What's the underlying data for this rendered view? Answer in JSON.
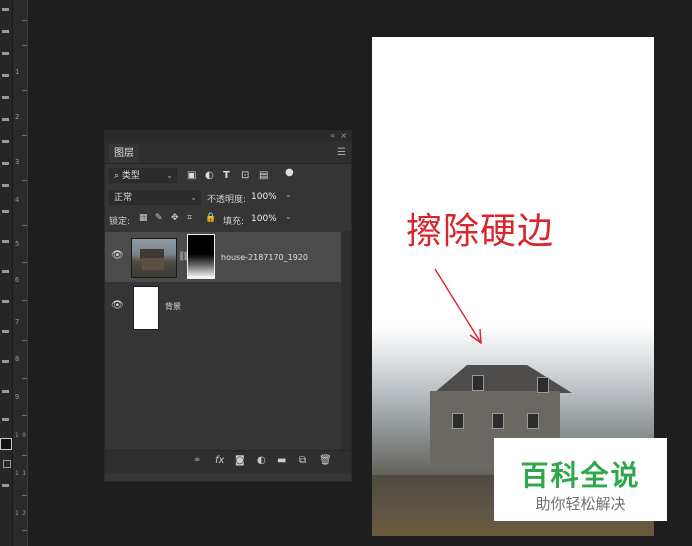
{
  "layers_panel": {
    "tab_label": "图层",
    "filter": {
      "search_icon": "⌕",
      "kind_label": "类型"
    },
    "blend_mode": "正常",
    "opacity_label": "不透明度:",
    "opacity_value": "100%",
    "lock_label": "锁定:",
    "fill_label": "填充:",
    "fill_value": "100%",
    "layers": [
      {
        "name": "house-2187170_1920",
        "visible": true,
        "selected": true,
        "has_mask": true
      },
      {
        "name": "背景",
        "visible": true,
        "selected": false,
        "has_mask": false
      }
    ]
  },
  "ruler": {
    "numbers": [
      "1",
      "2",
      "3",
      "4",
      "5",
      "6",
      "7",
      "8",
      "9",
      "1 0",
      "1 1",
      "1 2"
    ]
  },
  "annotation": {
    "text": "擦除硬边",
    "color": "#d9252b"
  },
  "watermark": {
    "title": "百科全说",
    "subtitle": "助你轻松解决",
    "title_color": "#2ea84a"
  }
}
